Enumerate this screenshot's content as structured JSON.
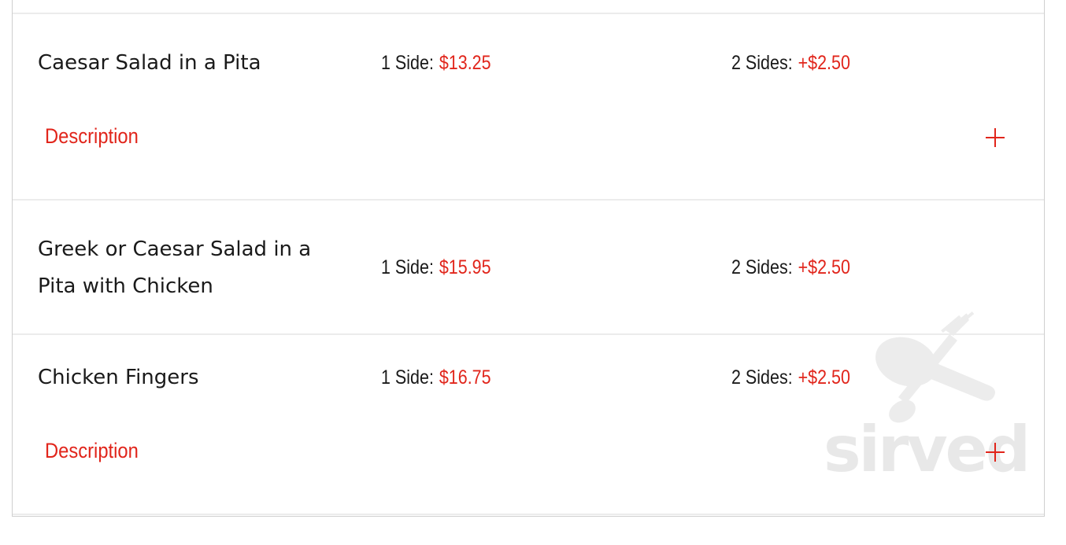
{
  "items": [
    {
      "name": "Caesar Salad in a Pita",
      "side1_label": "1 Side:",
      "side1_price": "$13.25",
      "side2_label": "2 Sides:",
      "side2_price": "+$2.50",
      "description_label": "Description"
    },
    {
      "name": "Greek or Caesar Salad in a Pita with Chicken",
      "side1_label": "1 Side:",
      "side1_price": "$15.95",
      "side2_label": "2 Sides:",
      "side2_price": "+$2.50"
    },
    {
      "name": "Chicken Fingers",
      "side1_label": "1 Side:",
      "side1_price": "$16.75",
      "side2_label": "2 Sides:",
      "side2_price": "+$2.50",
      "description_label": "Description"
    }
  ],
  "watermark": {
    "text": "sirved",
    "icon": "fork-and-spoon-icon"
  },
  "colors": {
    "accent": "#e1251b",
    "text": "#1a1a1a",
    "divider": "#ececec"
  }
}
